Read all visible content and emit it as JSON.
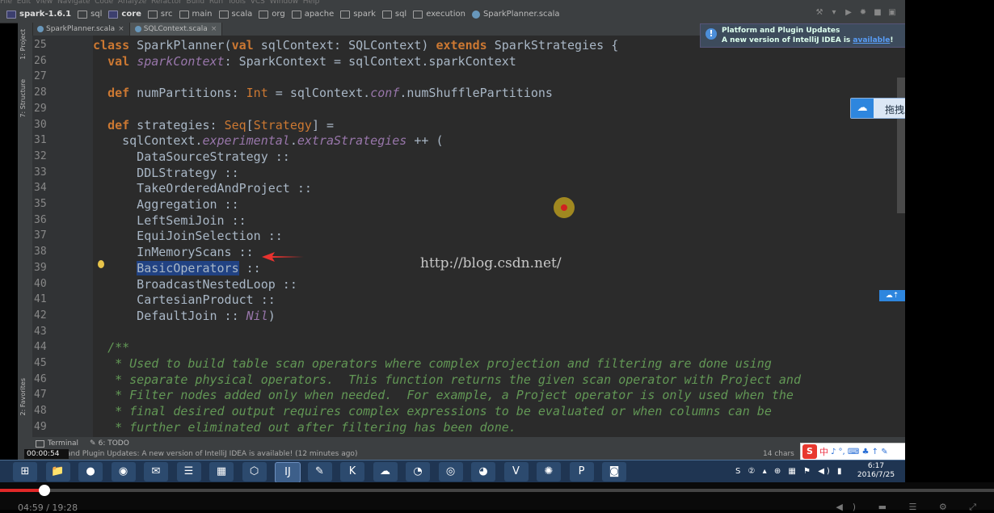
{
  "menu_strip": "File  Edit  View  Navigate  Code  Analyze  Refactor  Build  Run  Tools  VCS  Window  Help",
  "breadcrumbs": [
    "spark-1.6.1",
    "sql",
    "core",
    "src",
    "main",
    "scala",
    "org",
    "apache",
    "spark",
    "sql",
    "execution",
    "SparkPlanner.scala"
  ],
  "tabs": [
    {
      "label": "SparkPlanner.scala",
      "active": false
    },
    {
      "label": "SQLContext.scala",
      "active": true
    }
  ],
  "left_tools": [
    "1: Project",
    "7: Structure",
    "2: Favorites"
  ],
  "editor": {
    "lines": [
      {
        "n": "25",
        "html": "<span class=\"kw\">class</span> SparkPlanner(<span class=\"kw\">val</span> sqlContext: SQLContext) <span class=\"kw\">extends</span> SparkStrategies {"
      },
      {
        "n": "26",
        "html": "  <span class=\"kw\">val</span> <span class=\"it\">sparkContext</span>: SparkContext = sqlContext.sparkContext"
      },
      {
        "n": "27",
        "html": ""
      },
      {
        "n": "28",
        "html": "  <span class=\"kw\">def</span> numPartitions: <span class=\"ty\">Int</span> = sqlContext.<span class=\"it\">conf</span>.numShufflePartitions"
      },
      {
        "n": "29",
        "html": ""
      },
      {
        "n": "30",
        "html": "  <span class=\"kw\">def</span> strategies: <span class=\"ty\">Seq</span>[<span class=\"ty\">Strategy</span>] ="
      },
      {
        "n": "31",
        "html": "    sqlContext.<span class=\"it\">experimental</span>.<span class=\"it\">extraStrategies</span> ++ ("
      },
      {
        "n": "32",
        "html": "      DataSourceStrategy ::"
      },
      {
        "n": "33",
        "html": "      DDLStrategy ::"
      },
      {
        "n": "34",
        "html": "      TakeOrderedAndProject ::"
      },
      {
        "n": "35",
        "html": "      Aggregation ::"
      },
      {
        "n": "36",
        "html": "      LeftSemiJoin ::"
      },
      {
        "n": "37",
        "html": "      EquiJoinSelection ::"
      },
      {
        "n": "38",
        "html": "      InMemoryScans ::"
      },
      {
        "n": "39",
        "html": "      <span class=\"sel\">BasicOperators</span> ::"
      },
      {
        "n": "40",
        "html": "      BroadcastNestedLoop ::"
      },
      {
        "n": "41",
        "html": "      CartesianProduct ::"
      },
      {
        "n": "42",
        "html": "      DefaultJoin :: <span class=\"it\">Nil</span>)"
      },
      {
        "n": "43",
        "html": ""
      },
      {
        "n": "44",
        "html": "  <span class=\"cm\">/**</span>"
      },
      {
        "n": "45",
        "html": "<span class=\"cm\">   * Used to build table scan operators where complex projection and filtering are done using</span>"
      },
      {
        "n": "46",
        "html": "<span class=\"cm\">   * separate physical operators.  This function returns the given scan operator with Project and</span>"
      },
      {
        "n": "47",
        "html": "<span class=\"cm\">   * Filter nodes added only when needed.  For example, a Project operator is only used when the</span>"
      },
      {
        "n": "48",
        "html": "<span class=\"cm\">   * final desired output requires complex expressions to be evaluated or when columns can be</span>"
      },
      {
        "n": "49",
        "html": "<span class=\"cm\">   * further eliminated out after filtering has been done.</span>"
      }
    ],
    "watermark": "http://blog.csdn.net/"
  },
  "notification": {
    "title": "Platform and Plugin Updates",
    "body": "A new version of IntelliJ IDEA is",
    "link": "available"
  },
  "upload_button": "拖拽上传",
  "bottom_tools": [
    "Terminal",
    "6: TODO"
  ],
  "status_text": "and Plugin Updates: A new version of IntelliJ IDEA is available! (12 minutes ago)",
  "status_right": "14 chars",
  "timer": "00:00:54",
  "ime": "中",
  "clock": {
    "time": "6:17",
    "date": "2016/7/25"
  },
  "player": {
    "time": "04:59 / 19:28",
    "progress_percent": 4.5
  },
  "colors": {
    "accent": "#e02828",
    "editor_bg": "#2b2b2b",
    "keyword": "#cc7832"
  }
}
